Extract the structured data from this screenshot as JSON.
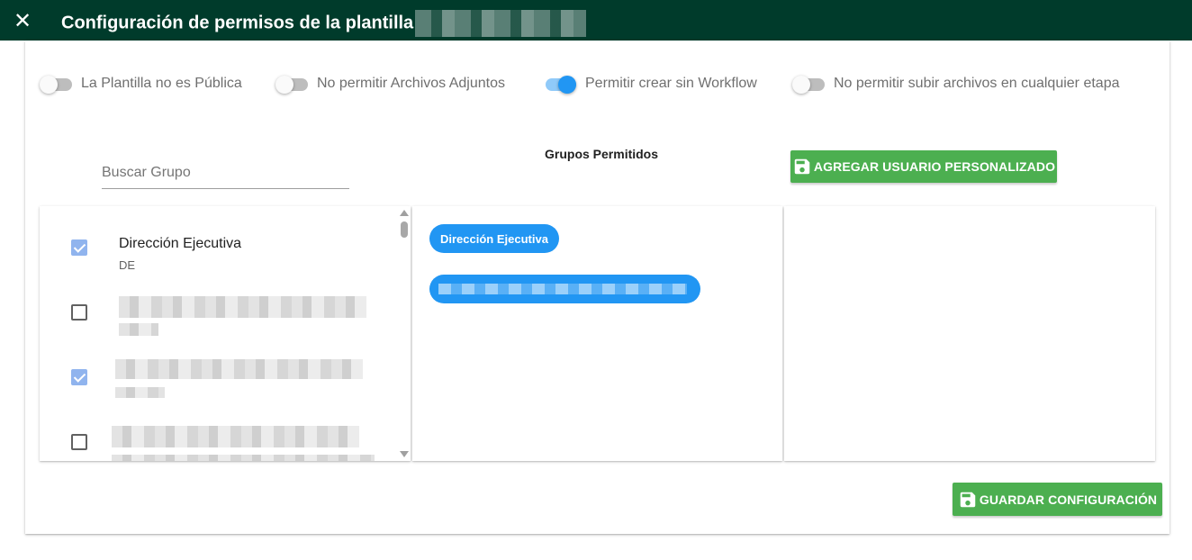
{
  "header": {
    "title": "Configuración de permisos de la plantilla",
    "close_icon": "close-icon"
  },
  "toggles": [
    {
      "label": "La Plantilla no es Pública",
      "on": false
    },
    {
      "label": "No permitir Archivos Adjuntos",
      "on": false
    },
    {
      "label": "Permitir crear sin Workflow",
      "on": true
    },
    {
      "label": "No permitir subir archivos en cualquier etapa",
      "on": false
    }
  ],
  "search": {
    "placeholder": "Buscar Grupo",
    "value": ""
  },
  "allowed_groups": {
    "title": "Grupos Permitidos",
    "chips": [
      "Dirección Ejecutiva"
    ]
  },
  "group_list": [
    {
      "name": "Dirección Ejecutiva",
      "code": "DE",
      "checked": true
    },
    {
      "checked": false
    },
    {
      "checked": true
    },
    {
      "checked": false
    }
  ],
  "buttons": {
    "add_custom_user": "AGREGAR USUARIO PERSONALIZADO",
    "save_config": "GUARDAR CONFIGURACIÓN",
    "save_icon": "save-icon"
  },
  "colors": {
    "header_bg": "#003b2b",
    "accent_blue": "#2196f3",
    "button_green": "#4caf50"
  }
}
